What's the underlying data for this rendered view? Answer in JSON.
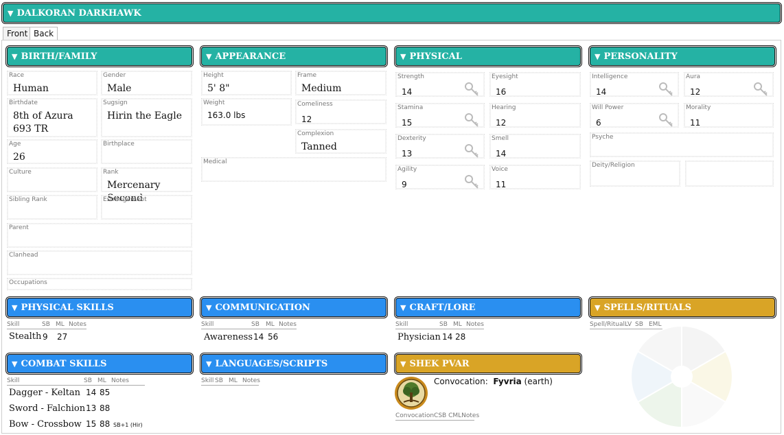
{
  "character_name": "DALKORAN DARKHAWK",
  "tabs": [
    "Front",
    "Back"
  ],
  "sections": {
    "birth": "BIRTH/FAMILY",
    "appearance": "APPEARANCE",
    "physical": "PHYSICAL",
    "personality": "PERSONALITY",
    "physical_skills": "PHYSICAL SKILLS",
    "communication": "COMMUNICATION",
    "craft_lore": "CRAFT/LORE",
    "spells": "SPELLS/RITUALS",
    "combat_skills": "COMBAT SKILLS",
    "languages": "LANGUAGES/SCRIPTS",
    "shek_pvar": "SHEK PVAR"
  },
  "birth": {
    "race_label": "Race",
    "race": "Human",
    "gender_label": "Gender",
    "gender": "Male",
    "birthdate_label": "Birthdate",
    "birthdate": "8th of Azura 693 TR",
    "sunsign_label": "Sugsign",
    "sunsign": "Hirin the Eagle",
    "age_label": "Age",
    "age": "26",
    "birthplace_label": "Birthplace",
    "culture_label": "Culture",
    "rank_label": "Rank",
    "rank": "Mercenary Second",
    "sibling_label": "Sibling Rank",
    "estrangement_label": "Estrangement",
    "parent_label": "Parent",
    "clanhead_label": "Clanhead",
    "occupations_label": "Occupations"
  },
  "appearance": {
    "height_label": "Height",
    "height": "5' 8\"",
    "frame_label": "Frame",
    "frame": "Medium",
    "weight_label": "Weight",
    "weight": "163.0 lbs",
    "comeliness_label": "Comeliness",
    "comeliness": "12",
    "complexion_label": "Complexion",
    "complexion": "Tanned",
    "medical_label": "Medical"
  },
  "physical": {
    "strength_label": "Strength",
    "strength": "14",
    "eyesight_label": "Eyesight",
    "eyesight": "16",
    "stamina_label": "Stamina",
    "stamina": "15",
    "hearing_label": "Hearing",
    "hearing": "12",
    "dexterity_label": "Dexterity",
    "dexterity": "13",
    "smell_label": "Smell",
    "smell": "14",
    "agility_label": "Agility",
    "agility": "9",
    "voice_label": "Voice",
    "voice": "11"
  },
  "personality": {
    "intelligence_label": "Intelligence",
    "intelligence": "14",
    "aura_label": "Aura",
    "aura": "12",
    "willpower_label": "Will Power",
    "willpower": "6",
    "morality_label": "Morality",
    "morality": "11",
    "psyche_label": "Psyche",
    "deity_label": "Deity/Religion"
  },
  "skill_cols": {
    "skill": "Skill",
    "sb": "SB",
    "ml": "ML",
    "notes": "Notes"
  },
  "physical_skills": [
    {
      "name": "Stealth",
      "sb": "9",
      "ml": "27"
    }
  ],
  "communication_skills": [
    {
      "name": "Awareness",
      "sb": "14",
      "ml": "56"
    }
  ],
  "craft_skills": [
    {
      "name": "Physician",
      "sb": "14",
      "ml": "28"
    }
  ],
  "spell_cols": {
    "spell": "Spell/Ritual",
    "lv": "LV",
    "sb": "SB",
    "eml": "EML"
  },
  "combat_skills": [
    {
      "name": "Dagger - Keltan",
      "sb": "14",
      "ml": "85",
      "notes": ""
    },
    {
      "name": "Sword - Falchion",
      "sb": "13",
      "ml": "88",
      "notes": ""
    },
    {
      "name": "Bow - Crossbow",
      "sb": "15",
      "ml": "88",
      "notes": "SB+1 (Hir)"
    }
  ],
  "lang_cols": {
    "skill": "Skill",
    "sb": "SB",
    "ml": "ML",
    "notes": "Notes"
  },
  "shek_pvar": {
    "convocation_prefix": "Convocation:",
    "convocation_name": "Fyvria",
    "convocation_element": "(earth)",
    "cols": {
      "convocation": "Convocation",
      "csb": "CSB",
      "cml": "CML",
      "notes": "Notes"
    }
  },
  "colors": {
    "teal": "#25b2a4",
    "blue": "#2a8ff0",
    "gold": "#d9a426"
  },
  "icons": {
    "key": "key-icon",
    "emblem": "fyvria-tree-emblem",
    "wheel": "convocation-wheel"
  }
}
